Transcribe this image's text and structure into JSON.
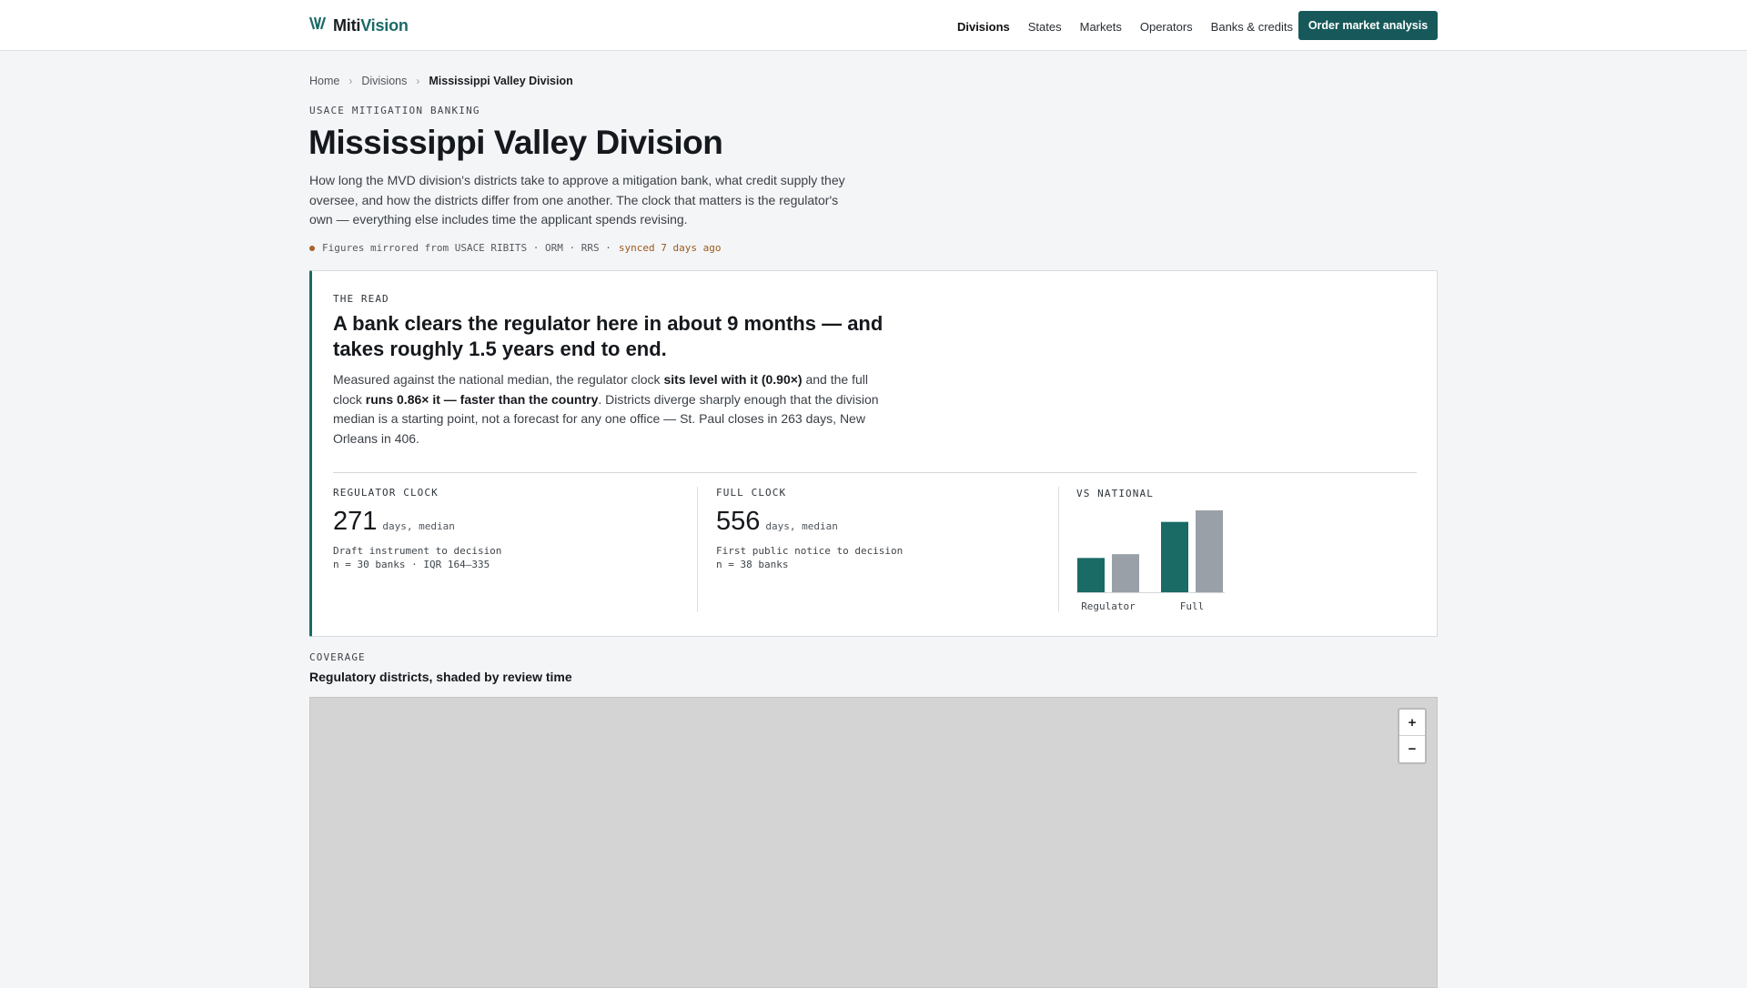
{
  "brand": {
    "name_part1": "Miti",
    "name_part2": "Vision"
  },
  "nav": {
    "items": [
      "Divisions",
      "States",
      "Markets",
      "Operators",
      "Banks & credits"
    ],
    "active": "Divisions",
    "cta": "Order market analysis"
  },
  "breadcrumb": [
    "Home",
    "Divisions",
    "Mississippi Valley Division"
  ],
  "page": {
    "eyebrow": "USACE MITIGATION BANKING",
    "title": "Mississippi Valley Division",
    "lede": "How long the MVD division's districts take to approve a mitigation bank, what credit supply they oversee, and how the districts differ from one another. The clock that matters is the regulator's own — everything else includes time the applicant spends revising.",
    "sync_source": "Figures mirrored from USACE RIBITS · ORM · RRS ·",
    "sync_age": "synced 7 days ago"
  },
  "read": {
    "kicker": "THE READ",
    "headline": "A bank clears the regulator here in about 9 months — and takes roughly 1.5 years end to end.",
    "body_1": "Measured against the national median, the regulator clock ",
    "body_b1": "sits level with it (0.90×)",
    "body_2": " and the full clock ",
    "body_b2": "runs 0.86× it — faster than the country",
    "body_3": ". Districts diverge sharply enough that the division median is a starting point, not a forecast for any one office — St. Paul closes in 263 days, New Orleans in 406."
  },
  "stats": {
    "regulator": {
      "label": "REGULATOR CLOCK",
      "value": "271",
      "unit": "days, median",
      "note1": "Draft instrument to decision",
      "note2": "n = 30 banks · IQR 164–335"
    },
    "full": {
      "label": "FULL CLOCK",
      "value": "556",
      "unit": "days, median",
      "note1": "First public notice to decision",
      "note2": "n = 38 banks"
    },
    "national": {
      "label": "VS NATIONAL"
    }
  },
  "chart_data": {
    "type": "bar",
    "categories": [
      "Regulator",
      "Full"
    ],
    "series": [
      {
        "values": [
          271,
          556
        ],
        "color": "#1a6a66"
      },
      {
        "values": [
          301,
          647
        ],
        "color": "#9aa0a8"
      }
    ]
  },
  "coverage": {
    "eyebrow": "COVERAGE",
    "title": "Regulatory districts, shaded by review time",
    "zoom_in": "+",
    "zoom_out": "−"
  }
}
